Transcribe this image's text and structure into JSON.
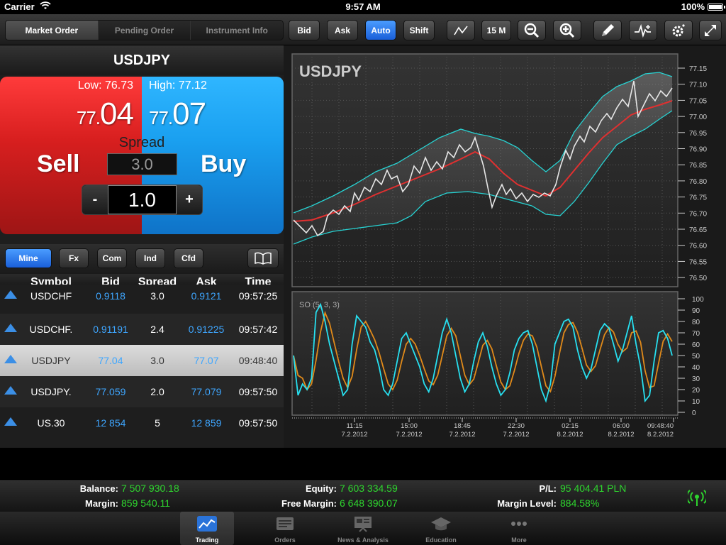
{
  "status": {
    "carrier": "Carrier",
    "time": "9:57 AM",
    "battery": "100%"
  },
  "toolbar": {
    "tabs": [
      "Market Order",
      "Pending Order",
      "Instrument Info"
    ],
    "bid": "Bid",
    "ask": "Ask",
    "auto": "Auto",
    "shift": "Shift",
    "timeframe": "15 M"
  },
  "order": {
    "symbol": "USDJPY",
    "low_label": "Low: 76.73",
    "high_label": "High: 77.12",
    "sell_price_prefix": "77.",
    "sell_price_main": "04",
    "buy_price_prefix": "77.",
    "buy_price_main": "07",
    "sell_label": "Sell",
    "buy_label": "Buy",
    "spread_label": "Spread",
    "spread_value": "3.0",
    "qty_minus": "-",
    "qty_plus": "+",
    "quantity": "1.0"
  },
  "filters": {
    "items": [
      "Mine",
      "Fx",
      "Com",
      "Ind",
      "Cfd"
    ],
    "active": "Mine"
  },
  "table": {
    "headers": {
      "symbol": "Symbol",
      "bid": "Bid",
      "spread": "Spread",
      "ask": "Ask",
      "time": "Time"
    },
    "rows": [
      {
        "symbol": "USDCHF",
        "bid": "0.9118",
        "spread": "3.0",
        "ask": "0.9121",
        "time": "09:57:25"
      },
      {
        "symbol": "USDCHF.",
        "bid": "0.91191",
        "spread": "2.4",
        "ask": "0.91225",
        "time": "09:57:42"
      },
      {
        "symbol": "USDJPY",
        "bid": "77.04",
        "spread": "3.0",
        "ask": "77.07",
        "time": "09:48:40"
      },
      {
        "symbol": "USDJPY.",
        "bid": "77.059",
        "spread": "2.0",
        "ask": "77.079",
        "time": "09:57:50"
      },
      {
        "symbol": "US.30",
        "bid": "12 854",
        "spread": "5",
        "ask": "12 859",
        "time": "09:57:50"
      }
    ]
  },
  "chart": {
    "title": "USDJPY",
    "price_ticks": [
      "77.15",
      "77.10",
      "77.05",
      "77.00",
      "76.95",
      "76.90",
      "76.85",
      "76.80",
      "76.75",
      "76.70",
      "76.65",
      "76.60",
      "76.55",
      "76.50"
    ],
    "osc_label": "SO (5, 3, 3)",
    "osc_ticks": [
      "100",
      "90",
      "80",
      "70",
      "60",
      "50",
      "40",
      "30",
      "20",
      "10",
      "0"
    ],
    "time_labels": [
      {
        "t": "11:15",
        "d": "7.2.2012"
      },
      {
        "t": "15:00",
        "d": "7.2.2012"
      },
      {
        "t": "18:45",
        "d": "7.2.2012"
      },
      {
        "t": "22:30",
        "d": "7.2.2012"
      },
      {
        "t": "02:15",
        "d": "8.2.2012"
      },
      {
        "t": "06:00",
        "d": "8.2.2012"
      },
      {
        "t": "09:48:40",
        "d": "8.2.2012"
      }
    ],
    "colors": {
      "price": "#e6e6e6",
      "ma": "#e03030",
      "bands": "#27d3d3",
      "so_k": "#27e0f0",
      "so_d": "#e08a1a"
    }
  },
  "account": {
    "balance_label": "Balance:",
    "balance": "7 507 930.18",
    "margin_label": "Margin:",
    "margin": "859 540.11",
    "equity_label": "Equity:",
    "equity": "7 603 334.59",
    "free_margin_label": "Free Margin:",
    "free_margin": "6 648 390.07",
    "pl_label": "P/L:",
    "pl": "95 404.41 PLN",
    "margin_level_label": "Margin Level:",
    "margin_level": "884.58%"
  },
  "tabbar": {
    "items": [
      {
        "label": "Trading",
        "icon": "trading-chart-icon"
      },
      {
        "label": "Orders",
        "icon": "orders-icon"
      },
      {
        "label": "News & Analysis",
        "icon": "news-icon"
      },
      {
        "label": "Education",
        "icon": "graduation-cap-icon"
      },
      {
        "label": "More",
        "icon": "more-dots-icon"
      }
    ],
    "active": "Trading"
  }
}
